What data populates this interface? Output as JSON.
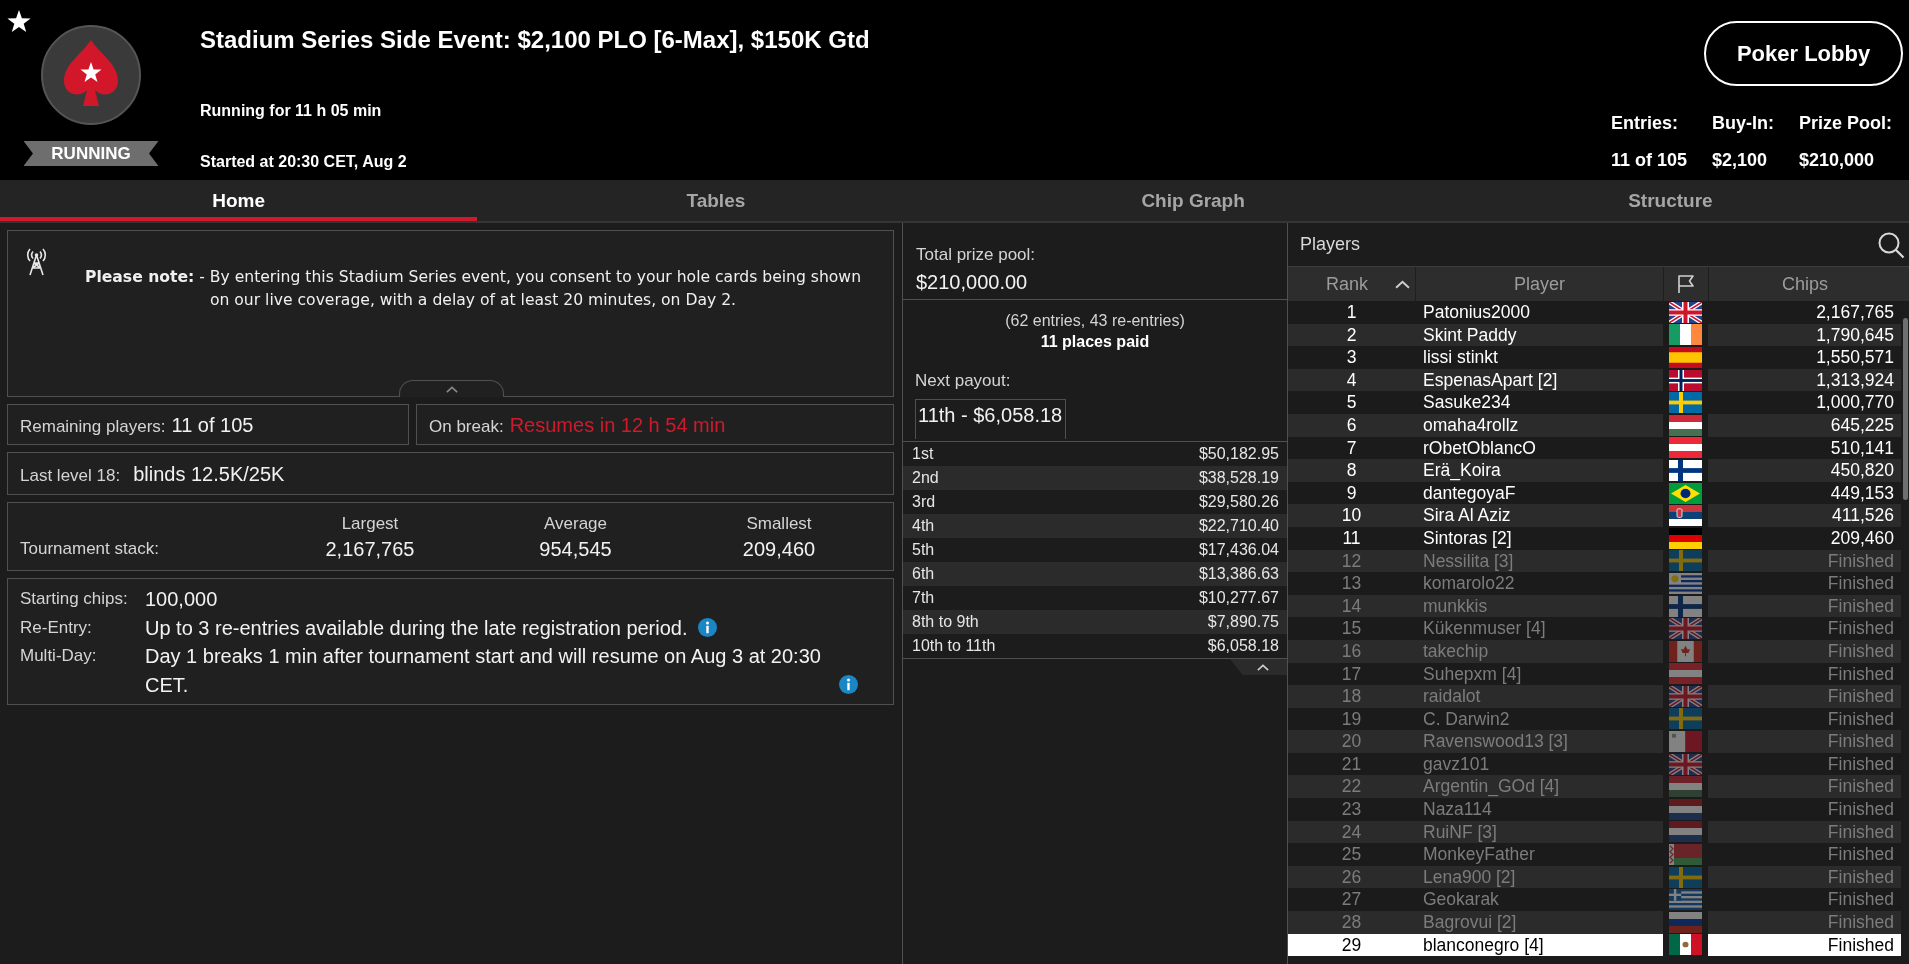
{
  "header": {
    "title": "Stadium Series Side Event: $2,100 PLO [6-Max], $150K Gtd",
    "status": "RUNNING",
    "running_for": "Running for 11 h 05 min",
    "started": "Started at 20:30 CET, Aug 2",
    "lobby_button": "Poker Lobby",
    "stats": [
      {
        "label": "Entries:",
        "value": "11 of 105"
      },
      {
        "label": "Buy-In:",
        "value": "$2,100"
      },
      {
        "label": "Prize Pool:",
        "value": "$210,000"
      }
    ]
  },
  "tabs": [
    {
      "label": "Home",
      "selected": true
    },
    {
      "label": "Tables",
      "selected": false
    },
    {
      "label": "Chip Graph",
      "selected": false
    },
    {
      "label": "Structure",
      "selected": false
    }
  ],
  "note": {
    "text": "**Please note:** - By entering this Stadium Series event, you consent to your hole cards being shown on our live coverage, with a delay of at least 20 minutes, on Day 2."
  },
  "remaining": {
    "label": "Remaining players:",
    "value": "11 of 105"
  },
  "break": {
    "label": "On break:",
    "value": "Resumes in 12 h 54 min"
  },
  "last_level": {
    "label": "Last level 18:",
    "value": "blinds 12.5K/25K"
  },
  "stack": {
    "label": "Tournament stack:",
    "columns": [
      {
        "label": "Largest",
        "value": "2,167,765"
      },
      {
        "label": "Average",
        "value": "954,545"
      },
      {
        "label": "Smallest",
        "value": "209,460"
      }
    ]
  },
  "details": [
    {
      "label": "Starting chips:",
      "value": "100,000",
      "info": false
    },
    {
      "label": "Re-Entry:",
      "value": "Up to 3 re-entries available during the late registration period.",
      "info": true
    },
    {
      "label": "Multi-Day:",
      "value": "Day 1 breaks 1 min after tournament start and will resume on Aug 3 at 20:30 CET.",
      "info": true
    }
  ],
  "prize": {
    "label": "Total prize pool:",
    "value": "$210,000.00",
    "entries": "(62 entries, 43 re-entries)",
    "places": "11 places paid",
    "next_label": "Next payout:",
    "next_value": "11th - $6,058.18",
    "payouts": [
      {
        "place": "1st",
        "amount": "$50,182.95"
      },
      {
        "place": "2nd",
        "amount": "$38,528.19"
      },
      {
        "place": "3rd",
        "amount": "$29,580.26"
      },
      {
        "place": "4th",
        "amount": "$22,710.40"
      },
      {
        "place": "5th",
        "amount": "$17,436.04"
      },
      {
        "place": "6th",
        "amount": "$13,386.63"
      },
      {
        "place": "7th",
        "amount": "$10,277.67"
      },
      {
        "place": "8th to 9th",
        "amount": "$7,890.75"
      },
      {
        "place": "10th to 11th",
        "amount": "$6,058.18"
      }
    ]
  },
  "players": {
    "title": "Players",
    "columns": [
      {
        "kind": "text",
        "label": "Rank",
        "sorted": true
      },
      {
        "kind": "text",
        "label": "Player",
        "sorted": false
      },
      {
        "kind": "flag",
        "sorted": false
      },
      {
        "kind": "text",
        "label": "Chips",
        "sorted": false
      }
    ],
    "rows": [
      {
        "rank": "1",
        "player": "Patonius2000",
        "kind": "uk",
        "chips": "2,167,765",
        "finished": false,
        "selected": false
      },
      {
        "rank": "2",
        "player": "Skint Paddy",
        "kind": "ireland",
        "chips": "1,790,645",
        "finished": false,
        "selected": false
      },
      {
        "rank": "3",
        "player": "lissi stinkt",
        "kind": "spain",
        "chips": "1,550,571",
        "finished": false,
        "selected": false
      },
      {
        "rank": "4",
        "player": "EspenasApart [2]",
        "kind": "norway",
        "chips": "1,313,924",
        "finished": false,
        "selected": false
      },
      {
        "rank": "5",
        "player": "Sasuke234",
        "kind": "sweden",
        "chips": "1,000,770",
        "finished": false,
        "selected": false
      },
      {
        "rank": "6",
        "player": "omaha4rollz",
        "kind": "hungary",
        "chips": "645,225",
        "finished": false,
        "selected": false
      },
      {
        "rank": "7",
        "player": "rObetOblancO",
        "kind": "austria",
        "chips": "510,141",
        "finished": false,
        "selected": false
      },
      {
        "rank": "8",
        "player": "Erä_Koira",
        "kind": "finland",
        "chips": "450,820",
        "finished": false,
        "selected": false
      },
      {
        "rank": "9",
        "player": "dantegoyaF",
        "kind": "brazil",
        "chips": "449,153",
        "finished": false,
        "selected": false
      },
      {
        "rank": "10",
        "player": "Sira Al Aziz",
        "kind": "serbia",
        "chips": "411,526",
        "finished": false,
        "selected": false
      },
      {
        "rank": "11",
        "player": "Sintoras [2]",
        "kind": "germany",
        "chips": "209,460",
        "finished": false,
        "selected": false
      },
      {
        "rank": "12",
        "player": "Nessilita [3]",
        "kind": "sweden",
        "chips": "Finished",
        "finished": true,
        "selected": false
      },
      {
        "rank": "13",
        "player": "komarolo22",
        "kind": "uruguay",
        "chips": "Finished",
        "finished": true,
        "selected": false
      },
      {
        "rank": "14",
        "player": "munkkis",
        "kind": "finland",
        "chips": "Finished",
        "finished": true,
        "selected": false
      },
      {
        "rank": "15",
        "player": "Kükenmuser [4]",
        "kind": "uk",
        "chips": "Finished",
        "finished": true,
        "selected": false
      },
      {
        "rank": "16",
        "player": "takechip",
        "kind": "canada",
        "chips": "Finished",
        "finished": true,
        "selected": false
      },
      {
        "rank": "17",
        "player": "Suhepxm [4]",
        "kind": "austria",
        "chips": "Finished",
        "finished": true,
        "selected": false
      },
      {
        "rank": "18",
        "player": "raidalot",
        "kind": "uk",
        "chips": "Finished",
        "finished": true,
        "selected": false
      },
      {
        "rank": "19",
        "player": "C. Darwin2",
        "kind": "sweden",
        "chips": "Finished",
        "finished": true,
        "selected": false
      },
      {
        "rank": "20",
        "player": "Ravenswood13 [3]",
        "kind": "malta",
        "chips": "Finished",
        "finished": true,
        "selected": false
      },
      {
        "rank": "21",
        "player": "gavz101",
        "kind": "uk",
        "chips": "Finished",
        "finished": true,
        "selected": false
      },
      {
        "rank": "22",
        "player": "Argentin_GOd [4]",
        "kind": "hungary",
        "chips": "Finished",
        "finished": true,
        "selected": false
      },
      {
        "rank": "23",
        "player": "Naza114",
        "kind": "netherlands",
        "chips": "Finished",
        "finished": true,
        "selected": false
      },
      {
        "rank": "24",
        "player": "RuiNF [3]",
        "kind": "netherlands",
        "chips": "Finished",
        "finished": true,
        "selected": false
      },
      {
        "rank": "25",
        "player": "MonkeyFather",
        "kind": "belarus",
        "chips": "Finished",
        "finished": true,
        "selected": false
      },
      {
        "rank": "26",
        "player": "Lena900 [2]",
        "kind": "sweden",
        "chips": "Finished",
        "finished": true,
        "selected": false
      },
      {
        "rank": "27",
        "player": "Geokarak",
        "kind": "greece",
        "chips": "Finished",
        "finished": true,
        "selected": false
      },
      {
        "rank": "28",
        "player": "Bagrovui [2]",
        "kind": "russia",
        "chips": "Finished",
        "finished": true,
        "selected": false
      },
      {
        "rank": "29",
        "player": "blanconegro [4]",
        "kind": "mexico",
        "chips": "Finished",
        "finished": true,
        "selected": true
      }
    ]
  }
}
